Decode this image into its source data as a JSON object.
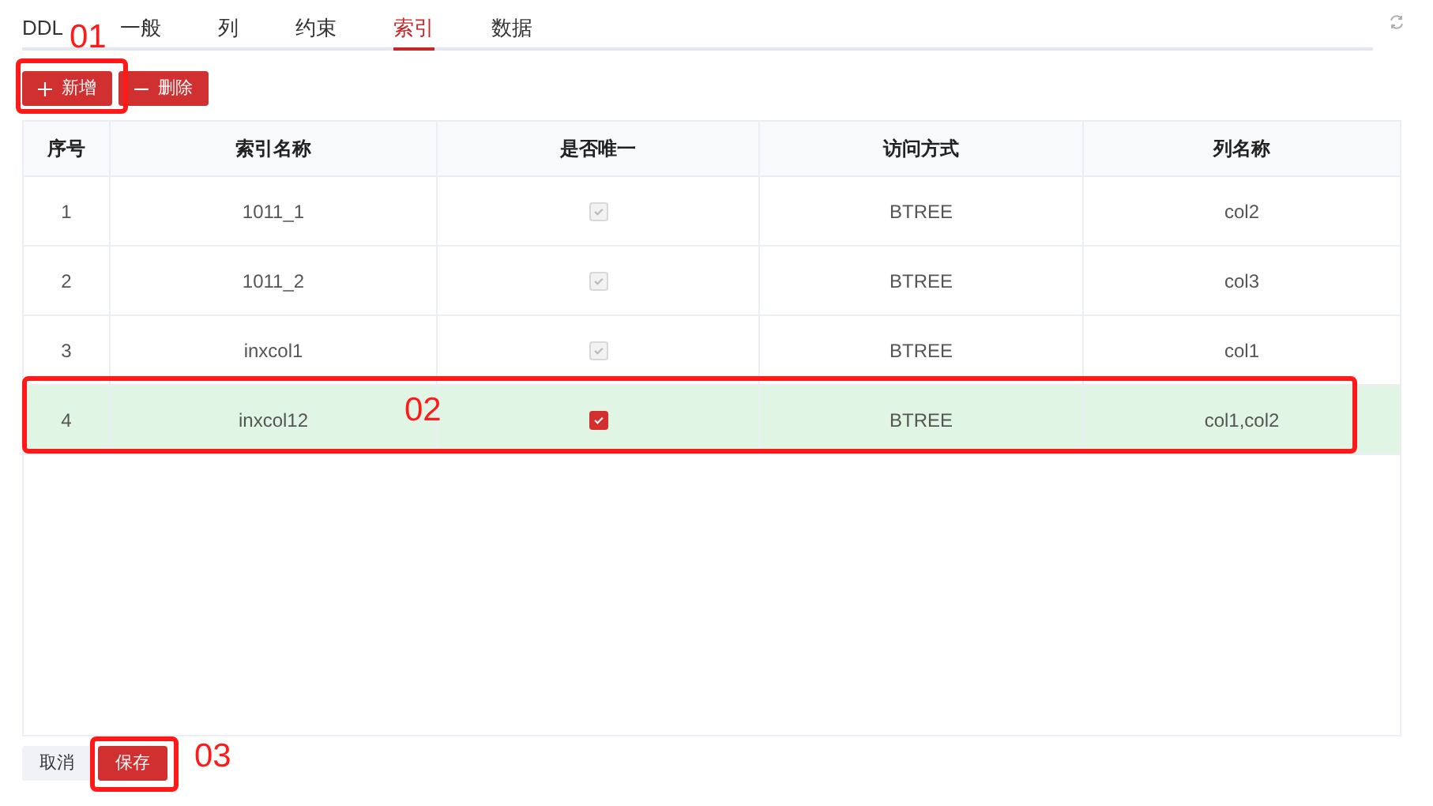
{
  "tabs": [
    {
      "label": "DDL",
      "selected": false
    },
    {
      "label": "一般",
      "selected": false
    },
    {
      "label": "列",
      "selected": false
    },
    {
      "label": "约束",
      "selected": false
    },
    {
      "label": "索引",
      "selected": true
    },
    {
      "label": "数据",
      "selected": false
    }
  ],
  "toolbar": [
    {
      "label": "新增",
      "kind": "add"
    },
    {
      "label": "删除",
      "kind": "remove"
    }
  ],
  "table": {
    "columns": [
      "序号",
      "索引名称",
      "是否唯一",
      "访问方式",
      "列名称"
    ],
    "rows": [
      {
        "index": "1",
        "name": "1011_1",
        "unique_checked": true,
        "disabled": true,
        "access": "BTREE",
        "columns": "col2",
        "selected": false
      },
      {
        "index": "2",
        "name": "1011_2",
        "unique_checked": true,
        "disabled": true,
        "access": "BTREE",
        "columns": "col3",
        "selected": false
      },
      {
        "index": "3",
        "name": "inxcol1",
        "unique_checked": true,
        "disabled": true,
        "access": "BTREE",
        "columns": "col1",
        "selected": false
      },
      {
        "index": "4",
        "name": "inxcol12",
        "unique_checked": true,
        "disabled": false,
        "access": "BTREE",
        "columns": "col1,col2",
        "selected": true
      }
    ]
  },
  "footer": [
    {
      "label": "取消",
      "kind": "cancel"
    },
    {
      "label": "保存",
      "kind": "primary"
    }
  ],
  "annotations": [
    {
      "label": "01"
    },
    {
      "label": "02"
    },
    {
      "label": "03"
    }
  ]
}
